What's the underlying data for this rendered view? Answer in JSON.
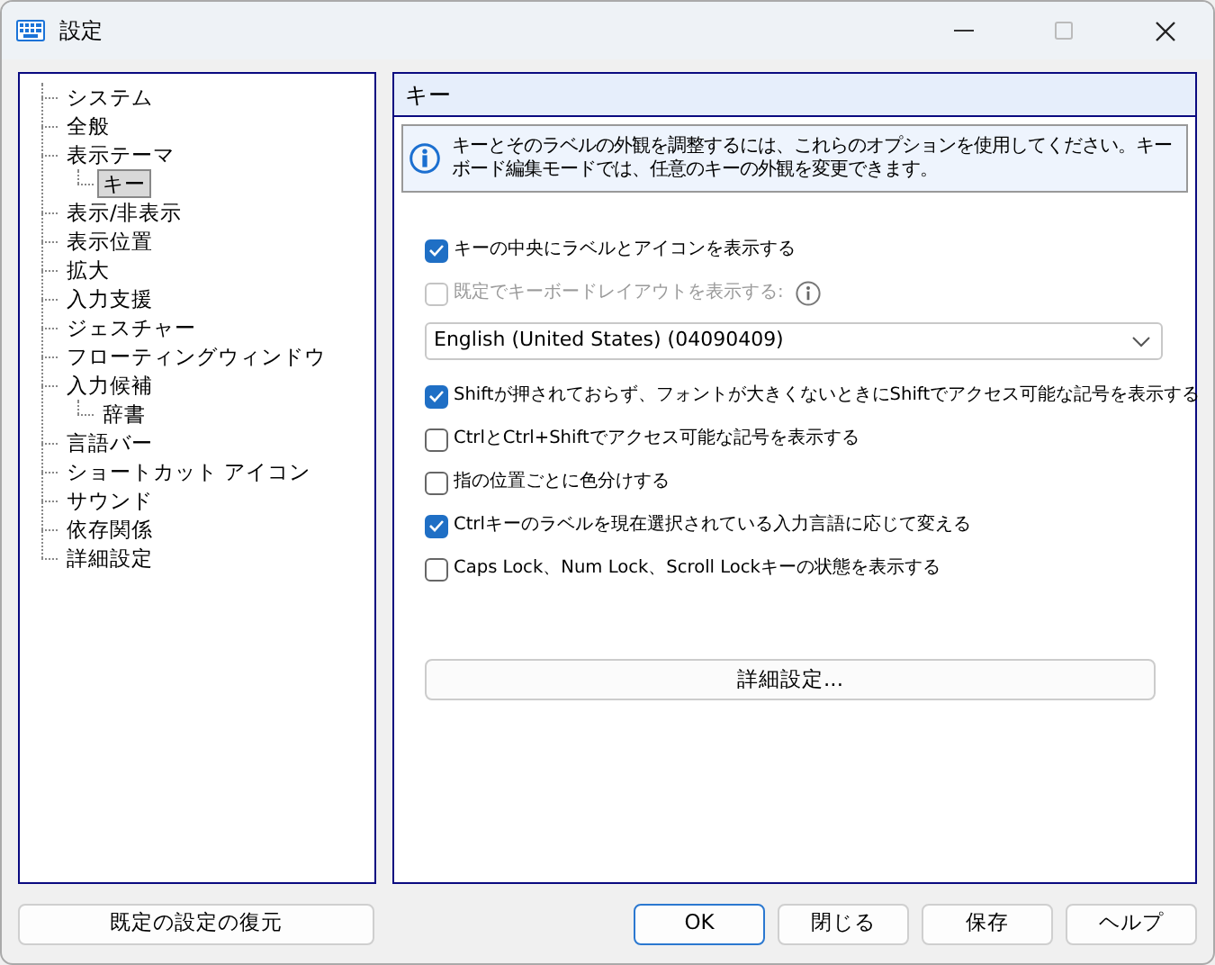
{
  "window": {
    "title": "設定"
  },
  "tree": [
    {
      "label": "システム",
      "selected": false
    },
    {
      "label": "全般",
      "selected": false
    },
    {
      "label": "表示テーマ",
      "selected": false,
      "children": [
        {
          "label": "キー",
          "selected": true
        }
      ]
    },
    {
      "label": "表示/非表示",
      "selected": false
    },
    {
      "label": "表示位置",
      "selected": false
    },
    {
      "label": "拡大",
      "selected": false
    },
    {
      "label": "入力支援",
      "selected": false
    },
    {
      "label": "ジェスチャー",
      "selected": false
    },
    {
      "label": "フローティングウィンドウ",
      "selected": false
    },
    {
      "label": "入力候補",
      "selected": false,
      "children": [
        {
          "label": "辞書",
          "selected": false
        }
      ]
    },
    {
      "label": "言語バー",
      "selected": false
    },
    {
      "label": "ショートカット アイコン",
      "selected": false
    },
    {
      "label": "サウンド",
      "selected": false
    },
    {
      "label": "依存関係",
      "selected": false
    },
    {
      "label": "詳細設定",
      "selected": false
    }
  ],
  "panel": {
    "title": "キー",
    "info": "キーとそのラベルの外観を調整するには、これらのオプションを使用してください。キーボード編集モードでは、任意のキーの外観を変更できます。",
    "controls": [
      {
        "kind": "checkbox",
        "label": "キーの中央にラベルとアイコンを表示する",
        "checked": true,
        "disabled": false,
        "info_icon": false
      },
      {
        "kind": "checkbox",
        "label": "既定でキーボードレイアウトを表示する:",
        "checked": false,
        "disabled": true,
        "info_icon": true
      },
      {
        "kind": "dropdown",
        "value": "English (United States) (04090409)"
      },
      {
        "kind": "checkbox",
        "label": "Shiftが押されておらず、フォントが大きくないときにShiftでアクセス可能な記号を表示する",
        "checked": true,
        "disabled": false,
        "info_icon": false
      },
      {
        "kind": "checkbox",
        "label": "CtrlとCtrl+Shiftでアクセス可能な記号を表示する",
        "checked": false,
        "disabled": false,
        "info_icon": false
      },
      {
        "kind": "checkbox",
        "label": "指の位置ごとに色分けする",
        "checked": false,
        "disabled": false,
        "info_icon": false
      },
      {
        "kind": "checkbox",
        "label": "Ctrlキーのラベルを現在選択されている入力言語に応じて変える",
        "checked": true,
        "disabled": false,
        "info_icon": false
      },
      {
        "kind": "checkbox",
        "label": "Caps Lock、Num Lock、Scroll Lockキーの状態を表示する",
        "checked": false,
        "disabled": false,
        "info_icon": false
      }
    ],
    "advanced_button": "詳細設定..."
  },
  "footer": {
    "restore_button": "既定の設定の復元",
    "buttons": [
      {
        "label": "OK",
        "default": true
      },
      {
        "label": "閉じる",
        "default": false
      },
      {
        "label": "保存",
        "default": false
      },
      {
        "label": "ヘルプ",
        "default": false
      }
    ]
  }
}
